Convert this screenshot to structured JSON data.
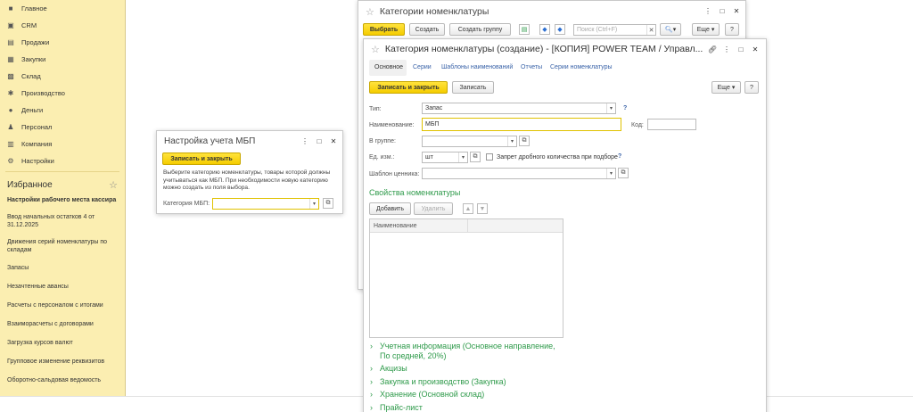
{
  "sidebar": {
    "nav": [
      {
        "label": "Главное",
        "icon": "home"
      },
      {
        "label": "CRM",
        "icon": "crm"
      },
      {
        "label": "Продажи",
        "icon": "sales"
      },
      {
        "label": "Закупки",
        "icon": "purchases"
      },
      {
        "label": "Склад",
        "icon": "warehouse"
      },
      {
        "label": "Производство",
        "icon": "production"
      },
      {
        "label": "Деньги",
        "icon": "money"
      },
      {
        "label": "Персонал",
        "icon": "person"
      },
      {
        "label": "Компания",
        "icon": "company"
      },
      {
        "label": "Настройки",
        "icon": "settings"
      }
    ],
    "favorites_title": "Избранное",
    "favorites": [
      "Настройки рабочего места кассира",
      "Ввод начальных остатков 4 от 31.12.2025",
      "Движения серий номенклатуры по складам",
      "Запасы",
      "Незачтенные авансы",
      "Расчеты с персоналом с итогами",
      "Взаиморасчеты с договорами",
      "Загрузка курсов валют",
      "Групповое изменение реквизитов",
      "Оборотно-сальдовая ведомость"
    ]
  },
  "mbp": {
    "title": "Настройка учета МБП",
    "save_close": "Записать и закрыть",
    "description": "Выберите категорию номенклатуры, товары которой должны учитываться как МБП. При необходимости новую категорию можно создать из поля выбора.",
    "category_label": "Категория МБП:",
    "category_value": ""
  },
  "catlist": {
    "title": "Категории номенклатуры",
    "select": "Выбрать",
    "create": "Создать",
    "create_group": "Создать группу",
    "search_placeholder": "Поиск (Ctrl+F)",
    "more": "Еще",
    "help": "?"
  },
  "form": {
    "title": "Категория номенклатуры (создание) - [КОПИЯ] POWER TEAM / Управл...",
    "tabs": [
      "Основное",
      "Серии",
      "Шаблоны наименований",
      "Отчеты",
      "Серии номенклатуры"
    ],
    "save_close": "Записать и закрыть",
    "save": "Записать",
    "more": "Еще",
    "help": "?",
    "type_label": "Тип:",
    "type_value": "Запас",
    "name_label": "Наименование:",
    "name_value": "МБП",
    "code_label": "Код:",
    "code_value": "",
    "group_label": "В группе:",
    "group_value": "",
    "unit_label": "Ед. изм.:",
    "unit_value": "шт",
    "fractional_label": "Запрет дробного количества при подборе",
    "price_tag_label": "Шаблон ценника:",
    "price_tag_value": "",
    "props_title": "Свойства номенклатуры",
    "add": "Добавить",
    "delete": "Удалить",
    "table_header": "Наименование",
    "sections": [
      "Учетная информация (Основное направление, По средней, 20%)",
      "Акцизы",
      "Закупка и производство (Закупка)",
      "Хранение (Основной склад)",
      "Прайс-лист"
    ]
  }
}
